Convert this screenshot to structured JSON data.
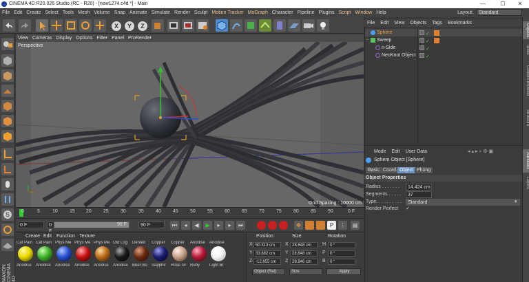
{
  "window": {
    "title": "CINEMA 4D R20.026 Studio (RC - R20) - [new1274.c4d *] - Main",
    "minimize": "—",
    "maximize": "☐",
    "close": "✕"
  },
  "menubar": {
    "items": [
      "File",
      "Edit",
      "Create",
      "Select",
      "Tools",
      "Mesh",
      "Volume",
      "Snap",
      "Animate",
      "Simulate",
      "Render",
      "Sculpt",
      "Motion Tracker",
      "MoGraph",
      "Character",
      "Pipeline",
      "Plugins",
      "Script",
      "Window",
      "Help"
    ],
    "layout_label": "Layout:",
    "layout_value": "Standard"
  },
  "toolbar": {
    "x_label": "X",
    "y_label": "Y",
    "z_label": "Z"
  },
  "viewport": {
    "menu": [
      "View",
      "Cameras",
      "Display",
      "Options",
      "Filter",
      "Panel",
      "ProRender"
    ],
    "camera_label": "Perspective",
    "grid_spacing": "Grid Spacing : 10000 cm"
  },
  "timeline": {
    "ticks": [
      "0",
      "5",
      "10",
      "15",
      "20",
      "25",
      "30",
      "35",
      "40",
      "45",
      "50",
      "55",
      "60",
      "65",
      "70",
      "75",
      "80",
      "85",
      "90"
    ],
    "end_label": "0 F"
  },
  "transport": {
    "current_frame": "0 F",
    "start_frame": "0 F",
    "preview_end": "90 F",
    "end_frame": "90 F"
  },
  "materials": {
    "menu": [
      "Create",
      "Edit",
      "Function",
      "Texture"
    ],
    "items": [
      {
        "name": "Cat Pain",
        "label": "Anodise",
        "color": "#e8d800"
      },
      {
        "name": "Cat Pain",
        "label": "Anodise",
        "color": "#3fb02a"
      },
      {
        "name": "Phys Me",
        "label": "Anodise",
        "color": "#2a50d0"
      },
      {
        "name": "Phys Me",
        "label": "Anodise",
        "color": "#c81010"
      },
      {
        "name": "Phys Me",
        "label": "Anodise",
        "color": "#b86a18"
      },
      {
        "name": "Old Log",
        "label": "Anodise",
        "color": "#1a1a1a"
      },
      {
        "name": "Dented",
        "label": "Beer Bo",
        "color": "#6a2a12"
      },
      {
        "name": "Copper",
        "label": "Sapphir",
        "color": "#1c1c6e"
      },
      {
        "name": "Copper",
        "label": "Rose Gl",
        "color": "#c8a088"
      },
      {
        "name": "Anodise",
        "label": "Ruby",
        "color": "#b81a38"
      },
      {
        "name": "Anodise",
        "label": "Light Br",
        "color": "#f4f4f4"
      }
    ]
  },
  "coordinates": {
    "headers": [
      "Position",
      "Size",
      "Rotation"
    ],
    "rows": [
      {
        "axis": "X",
        "pos": "50.313 cm",
        "size_axis": "X",
        "size": "28.848 cm",
        "rot_axis": "H",
        "rot": "0 °"
      },
      {
        "axis": "Y",
        "pos": "33.882 cm",
        "size_axis": "Y",
        "size": "28.848 cm",
        "rot_axis": "P",
        "rot": "0 °"
      },
      {
        "axis": "Z",
        "pos": "-12.655 cm",
        "size_axis": "Z",
        "size": "28.846 cm",
        "rot_axis": "B",
        "rot": "0 °"
      }
    ],
    "mode": "Object (Rel)",
    "size_mode": "Size",
    "apply": "Apply"
  },
  "objects": {
    "menu": [
      "File",
      "Edit",
      "View",
      "Objects",
      "Tags",
      "Bookmarks"
    ],
    "items": [
      {
        "name": "Sphere",
        "indent": 0,
        "color": "#4aa0f0"
      },
      {
        "name": "Sweep",
        "indent": 0,
        "color": "#5cc05c"
      },
      {
        "name": "n-Side",
        "indent": 1,
        "color": "#9a6ac8"
      },
      {
        "name": "NeoKnot Object",
        "indent": 1,
        "color": "#9a6ac8"
      }
    ]
  },
  "attributes": {
    "menu": [
      "Mode",
      "Edit",
      "User Data"
    ],
    "object_title": "Sphere Object [Sphere]",
    "tabs": [
      "Basic",
      "Coord.",
      "Object",
      "Phong"
    ],
    "active_tab": "Object",
    "section": "Object Properties",
    "radius_label": "Radius . . . . . . .",
    "radius_value": "14.424 cm",
    "segments_label": "Segments . . . . .",
    "segments_value": "37",
    "type_label": "Type. . . . . . . . . .",
    "type_value": "Standard",
    "render_perfect_label": "Render Perfect",
    "render_perfect_value": "✓"
  },
  "right_tabs": [
    "Objects",
    "Takes",
    "Content Browser",
    "Structure",
    "Attributes",
    "Layers"
  ]
}
